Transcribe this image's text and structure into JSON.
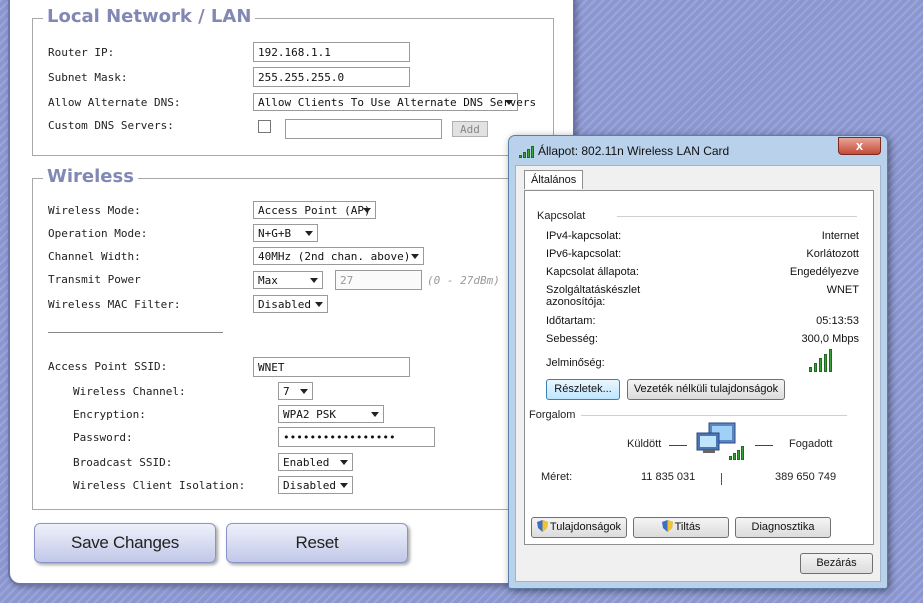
{
  "router": {
    "lan": {
      "legend": "Local Network / LAN",
      "router_ip_label": "Router IP:",
      "router_ip": "192.168.1.1",
      "subnet_label": "Subnet Mask:",
      "subnet": "255.255.255.0",
      "alt_dns_label": "Allow Alternate DNS:",
      "alt_dns_value": "Allow Clients To Use Alternate DNS Servers",
      "custom_dns_label": "Custom DNS Servers:",
      "custom_dns_value": "",
      "add_label": "Add"
    },
    "wireless": {
      "legend": "Wireless",
      "mode_label": "Wireless Mode:",
      "mode_value": "Access Point (AP)",
      "op_label": "Operation Mode:",
      "op_value": "N+G+B",
      "width_label": "Channel Width:",
      "width_value": "40MHz (2nd chan. above)",
      "power_label": "Transmit Power",
      "power_value": "Max",
      "power_input": "27",
      "power_hint": "(0 - 27dBm)",
      "mac_label": "Wireless MAC Filter:",
      "mac_value": "Disabled",
      "ssid_label": "Access Point SSID:",
      "ssid_value": "WNET",
      "channel_label": "Wireless Channel:",
      "channel_value": "7",
      "enc_label": "Encryption:",
      "enc_value": "WPA2 PSK",
      "pass_label": "Password:",
      "pass_value": "•••••••••••••••••",
      "bcast_label": "Broadcast SSID:",
      "bcast_value": "Enabled",
      "iso_label": "Wireless Client Isolation:",
      "iso_value": "Disabled"
    },
    "save_label": "Save Changes",
    "reset_label": "Reset"
  },
  "dialog": {
    "title": "Állapot: 802.11n Wireless LAN Card",
    "close": "x",
    "tab": "Általános",
    "conn_group": "Kapcsolat",
    "rows": [
      {
        "label": "IPv4-kapcsolat:",
        "value": "Internet"
      },
      {
        "label": "IPv6-kapcsolat:",
        "value": "Korlátozott"
      },
      {
        "label": "Kapcsolat állapota:",
        "value": "Engedélyezve"
      },
      {
        "label": "Szolgáltatáskészlet azonosítója:",
        "value": "WNET"
      },
      {
        "label": "Időtartam:",
        "value": "05:13:53"
      },
      {
        "label": "Sebesség:",
        "value": "300,0 Mbps"
      }
    ],
    "signal_label": "Jelminőség:",
    "signal_level": 5,
    "details_btn": "Részletek...",
    "wireless_props_btn": "Vezeték nélküli tulajdonságok",
    "traffic_group": "Forgalom",
    "sent_label": "Küldött",
    "recv_label": "Fogadott",
    "size_label": "Méret:",
    "sent_value": "11 835 031",
    "recv_value": "389 650 749",
    "props_btn": "Tulajdonságok",
    "disable_btn": "Tiltás",
    "diag_btn": "Diagnosztika",
    "close_btn": "Bezárás"
  }
}
